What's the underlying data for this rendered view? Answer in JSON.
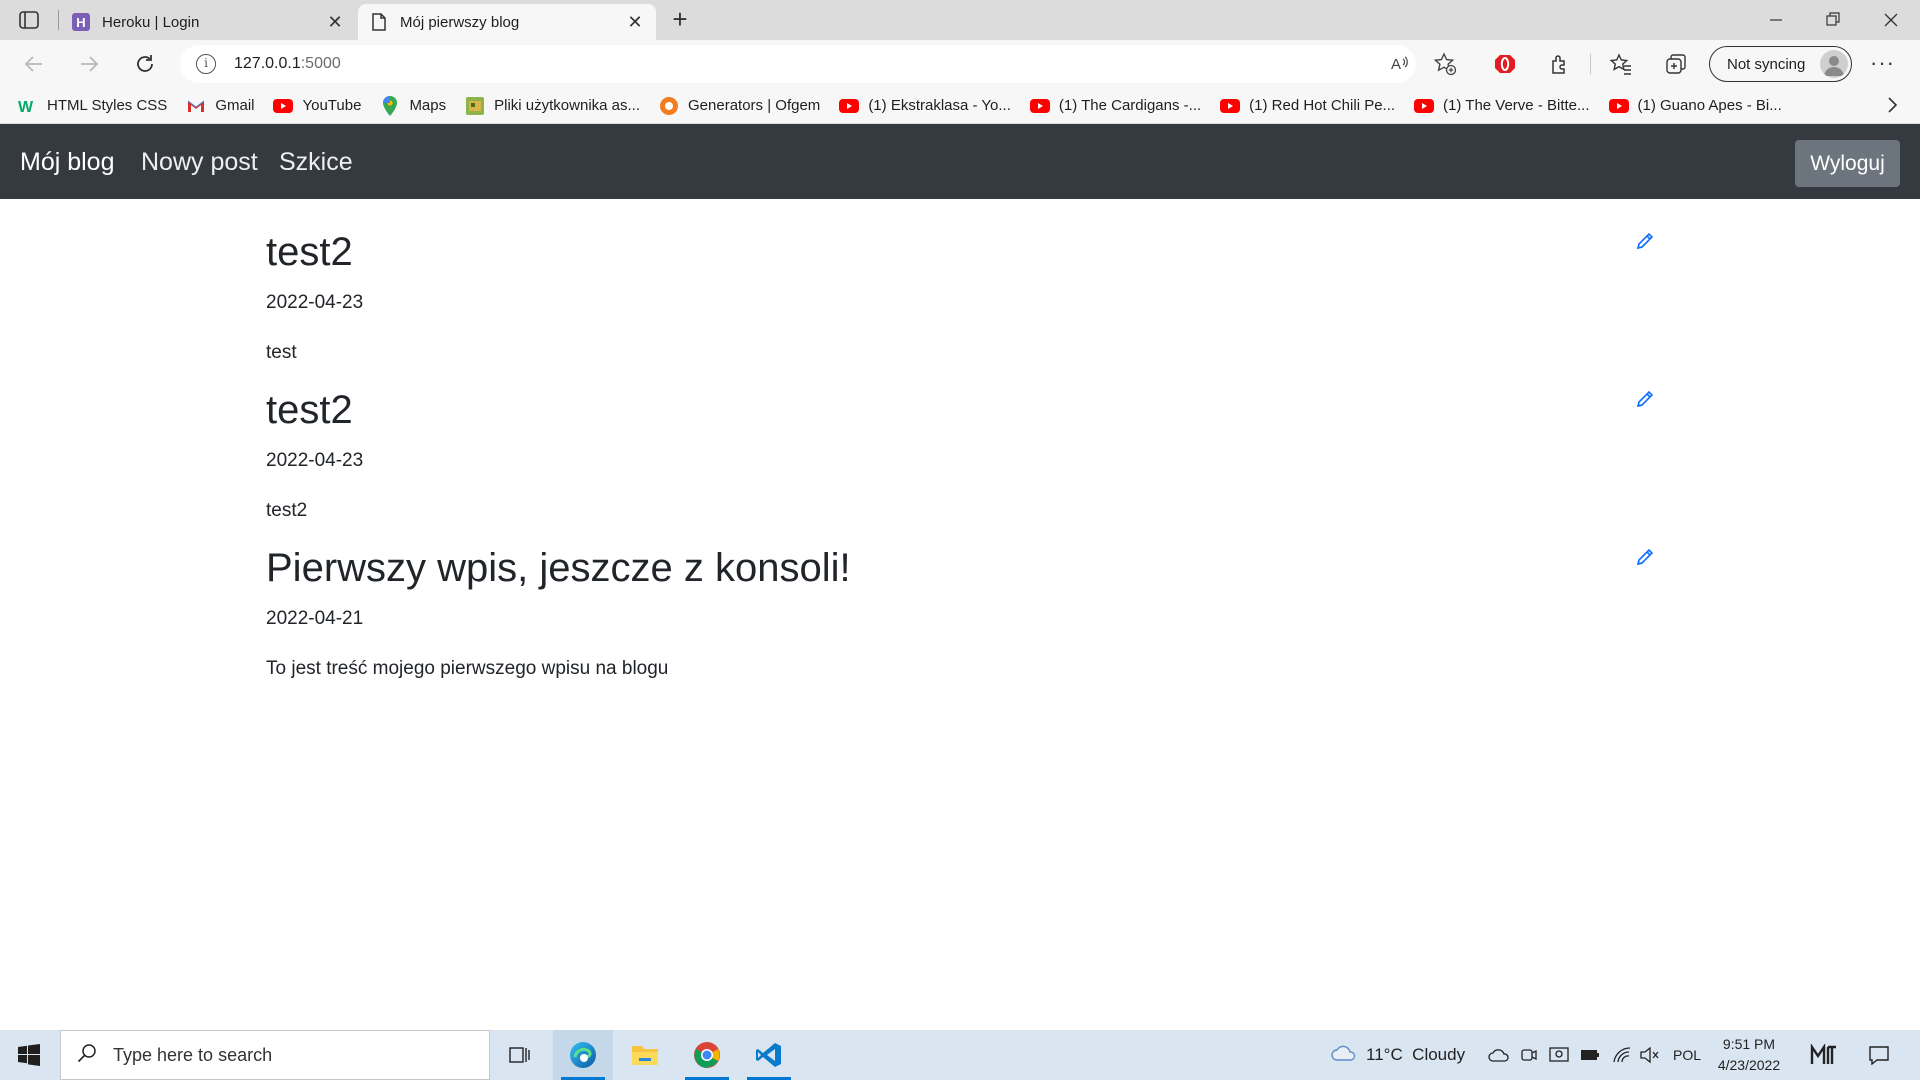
{
  "browser": {
    "tabs": [
      {
        "title": "Heroku | Login",
        "active": false,
        "icon": "heroku-icon"
      },
      {
        "title": "Mój pierwszy blog",
        "active": true,
        "icon": "page-icon"
      }
    ],
    "address": {
      "host": "127.0.0.1",
      "port": ":5000"
    },
    "profile_label": "Not syncing",
    "bookmarks": [
      {
        "label": "HTML Styles CSS",
        "icon": "w3schools-icon"
      },
      {
        "label": "Gmail",
        "icon": "gmail-icon"
      },
      {
        "label": "YouTube",
        "icon": "youtube-icon"
      },
      {
        "label": "Maps",
        "icon": "maps-icon"
      },
      {
        "label": "Pliki użytkownika as...",
        "icon": "files-icon"
      },
      {
        "label": "Generators | Ofgem",
        "icon": "ofgem-icon"
      },
      {
        "label": "(1) Ekstraklasa - Yo...",
        "icon": "youtube-icon"
      },
      {
        "label": "(1) The Cardigans -...",
        "icon": "youtube-icon"
      },
      {
        "label": "(1) Red Hot Chili Pe...",
        "icon": "youtube-icon"
      },
      {
        "label": "(1) The Verve - Bitte...",
        "icon": "youtube-icon"
      },
      {
        "label": "(1) Guano Apes - Bi...",
        "icon": "youtube-icon"
      }
    ]
  },
  "navbar": {
    "brand": "Mój blog",
    "links": [
      "Nowy post",
      "Szkice"
    ],
    "logout": "Wyloguj"
  },
  "posts": [
    {
      "title": "test2",
      "date": "2022-04-23",
      "body": "test"
    },
    {
      "title": "test2",
      "date": "2022-04-23",
      "body": "test2"
    },
    {
      "title": "Pierwszy wpis, jeszcze z konsoli!",
      "date": "2022-04-21",
      "body": "To jest treść mojego pierwszego wpisu na blogu"
    }
  ],
  "taskbar": {
    "search_placeholder": "Type here to search",
    "weather": "11°C  Cloudy",
    "language": "POL",
    "time": "9:51 PM",
    "date": "4/23/2022"
  },
  "colors": {
    "navbar": "#343a40",
    "logout_button": "#6c757d",
    "edit_icon": "#0d6efd",
    "taskbar": "#d9e6f2"
  }
}
